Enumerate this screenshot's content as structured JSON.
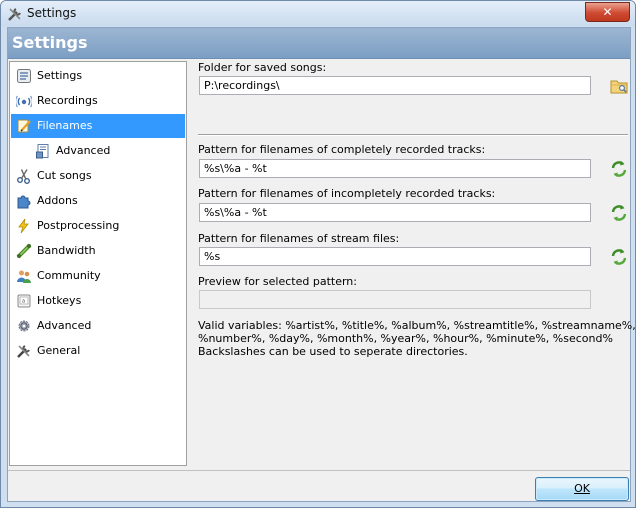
{
  "window": {
    "title": "Settings",
    "icon": "tools-icon",
    "close_label": "✕"
  },
  "header": {
    "title": "Settings"
  },
  "sidebar": {
    "items": [
      {
        "label": "Settings",
        "icon": "settings-icon",
        "selected": false
      },
      {
        "label": "Recordings",
        "icon": "radio-icon",
        "selected": false
      },
      {
        "label": "Filenames",
        "icon": "rename-icon",
        "selected": true
      },
      {
        "label": "Advanced",
        "icon": "advanced-file-icon",
        "selected": false,
        "indent": true
      },
      {
        "label": "Cut songs",
        "icon": "scissors-icon",
        "selected": false
      },
      {
        "label": "Addons",
        "icon": "puzzle-icon",
        "selected": false
      },
      {
        "label": "Postprocessing",
        "icon": "lightning-icon",
        "selected": false
      },
      {
        "label": "Bandwidth",
        "icon": "bandwidth-icon",
        "selected": false
      },
      {
        "label": "Community",
        "icon": "community-icon",
        "selected": false
      },
      {
        "label": "Hotkeys",
        "icon": "keyboard-icon",
        "selected": false
      },
      {
        "label": "Advanced",
        "icon": "gear-icon",
        "selected": false
      },
      {
        "label": "General",
        "icon": "tools-icon",
        "selected": false
      }
    ]
  },
  "main": {
    "folder_label": "Folder for saved songs:",
    "folder_value": "P:\\recordings\\",
    "complete_label": "Pattern for filenames of completely recorded tracks:",
    "complete_value": "%s\\%a - %t",
    "incomplete_label": "Pattern for filenames of incompletely recorded tracks:",
    "incomplete_value": "%s\\%a - %t",
    "stream_label": "Pattern for filenames of stream files:",
    "stream_value": "%s",
    "preview_label": "Preview for selected pattern:",
    "preview_value": "",
    "vars_line1": "Valid variables: %artist%, %title%, %album%, %streamtitle%, %streamname%,",
    "vars_line2": "%number%, %day%, %month%, %year%, %hour%, %minute%, %second%",
    "vars_line3": "Backslashes can be used to seperate directories."
  },
  "footer": {
    "ok_label": "OK"
  },
  "colors": {
    "header_bg": "#8fadd0",
    "selection": "#3399ff",
    "close_button": "#c9462f"
  }
}
